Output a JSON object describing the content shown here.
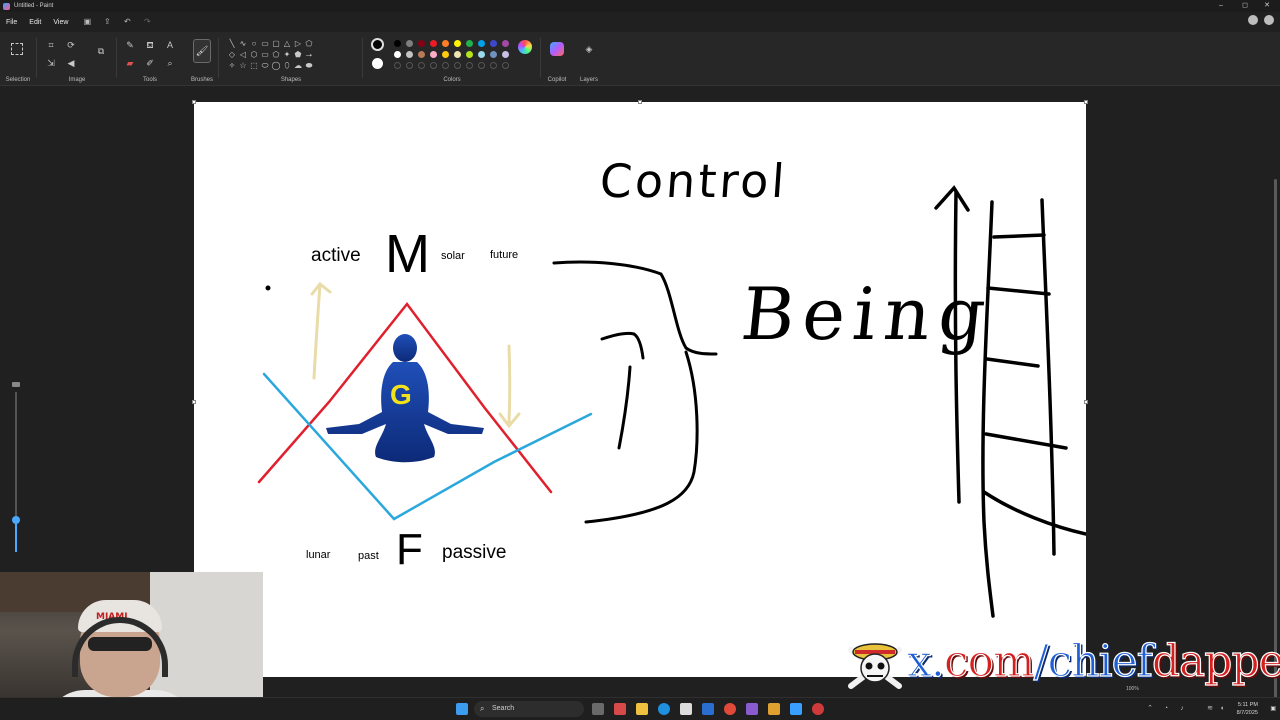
{
  "window": {
    "title": "Untitled - Paint",
    "controls": [
      "–",
      "◻",
      "✕"
    ]
  },
  "menu": {
    "items": [
      "File",
      "Edit",
      "View"
    ]
  },
  "ribbon": {
    "groups": {
      "selection": "Selection",
      "image": "Image",
      "tools": "Tools",
      "brushes": "Brushes",
      "shapes": "Shapes",
      "colors": "Colors",
      "copilot": "Copilot",
      "layers": "Layers"
    },
    "palette_row1": [
      "#000000",
      "#7f7f7f",
      "#880015",
      "#ed1c24",
      "#ff7f27",
      "#fff200",
      "#22b14c",
      "#00a2e8",
      "#3f48cc",
      "#a349a4"
    ],
    "palette_row2": [
      "#ffffff",
      "#c3c3c3",
      "#b97a57",
      "#ffaec9",
      "#ffc90e",
      "#efe4b0",
      "#b5e61d",
      "#99d9ea",
      "#7092be",
      "#c8bfe7"
    ],
    "color1": "#000000",
    "color2": "#ffffff"
  },
  "canvas_text": {
    "control": "Control",
    "being": "Being",
    "active": "active",
    "M": "M",
    "solar": "solar",
    "future": "future",
    "G": "G",
    "lunar": "lunar",
    "past": "past",
    "F": "F",
    "passive": "passive"
  },
  "zoom": {
    "level_fraction": 0.1
  },
  "webcam": {
    "cap_text": "MIAMI"
  },
  "watermark": {
    "prefix": "x.",
    "red_part": "com",
    "suffix": "/chief",
    "red_end": "dapper"
  },
  "taskbar": {
    "search_placeholder": "Search",
    "time": "5:11 PM",
    "date": "8/7/2025",
    "zoom_indicator": "100%"
  },
  "colors": {
    "red_line": "#e0202e",
    "blue_line": "#2aa8dd",
    "arrow_tan": "#e9dca8",
    "figure_blue": "#1a3fa0",
    "letter_yellow": "#f2e21a",
    "accent": "#4aa8ff"
  }
}
